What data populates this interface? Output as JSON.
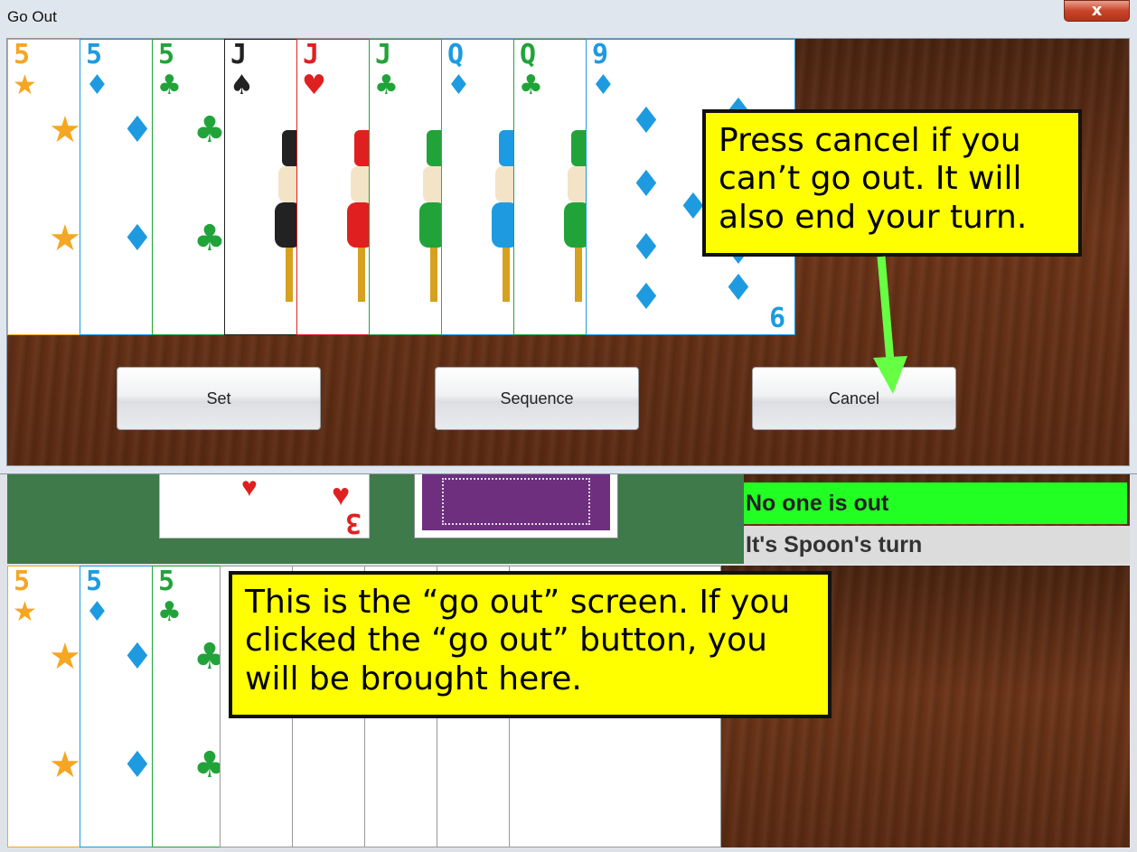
{
  "dialog": {
    "title": "Go Out",
    "close_label": "x",
    "buttons": {
      "set": "Set",
      "sequence": "Sequence",
      "cancel": "Cancel"
    },
    "hand": [
      {
        "rank": "5",
        "suit": "★",
        "color": "#f5a623"
      },
      {
        "rank": "5",
        "suit": "♦",
        "color": "#1e9be0"
      },
      {
        "rank": "5",
        "suit": "♣",
        "color": "#22a33a"
      },
      {
        "rank": "J",
        "suit": "♠",
        "color": "#222222"
      },
      {
        "rank": "J",
        "suit": "♥",
        "color": "#e02020"
      },
      {
        "rank": "J",
        "suit": "♣",
        "color": "#22a33a"
      },
      {
        "rank": "Q",
        "suit": "♦",
        "color": "#1e9be0"
      },
      {
        "rank": "Q",
        "suit": "♣",
        "color": "#22a33a"
      },
      {
        "rank": "9",
        "suit": "♦",
        "color": "#1e9be0"
      }
    ]
  },
  "background_game": {
    "discard_rank": "3",
    "status_out": "No one is out",
    "status_turn": "It's Spoon's turn",
    "hand": [
      {
        "rank": "5",
        "suit": "★",
        "color": "#f5a623"
      },
      {
        "rank": "5",
        "suit": "♦",
        "color": "#1e9be0"
      },
      {
        "rank": "5",
        "suit": "♣",
        "color": "#22a33a"
      }
    ]
  },
  "annotations": {
    "cancel_note": "Press cancel if you can’t go out. It will also end your turn.",
    "screen_note": "This is the “go out” screen. If you clicked the “go out” button, you will be brought here."
  },
  "colors": {
    "status_green": "#22ff22",
    "callout": "#ffff00",
    "arrow": "#66ff44"
  }
}
